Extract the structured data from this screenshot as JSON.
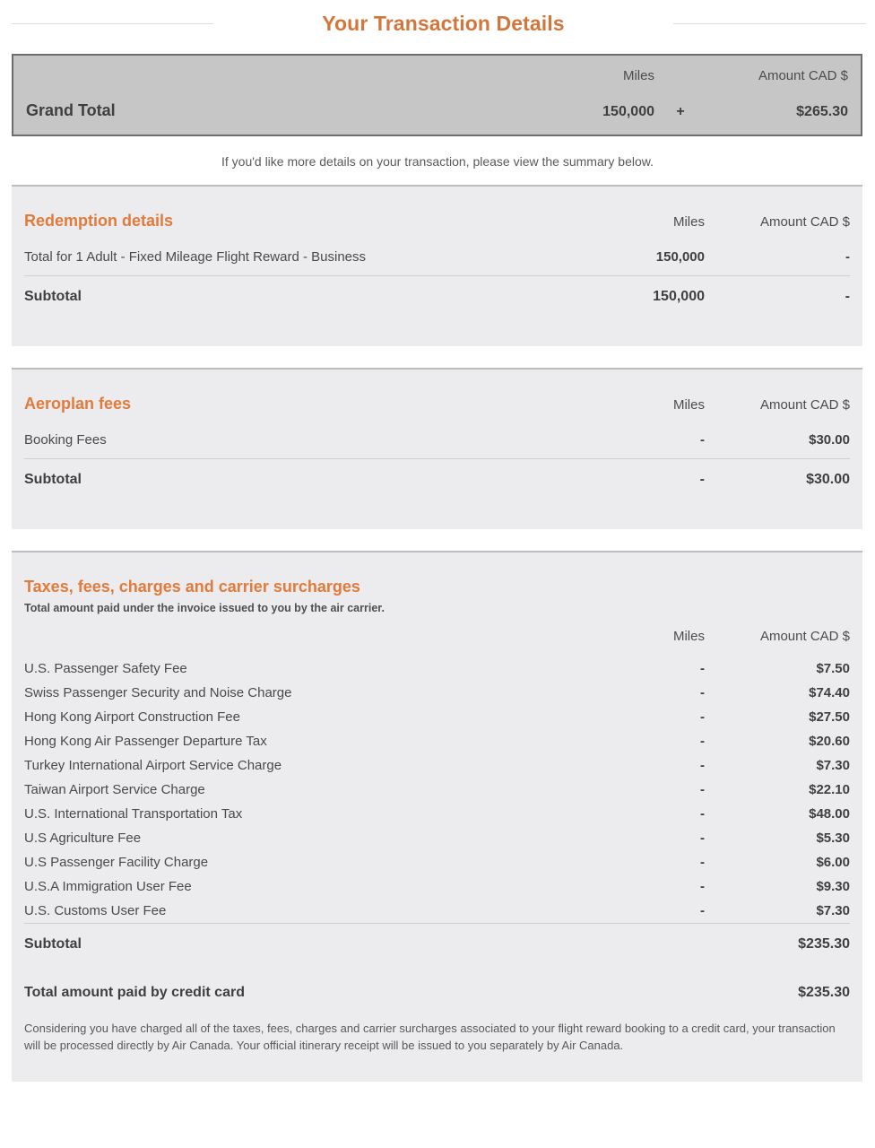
{
  "header": {
    "title": "Your Transaction Details"
  },
  "grand_total": {
    "miles_header": "Miles",
    "amount_header": "Amount CAD $",
    "label": "Grand Total",
    "miles": "150,000",
    "operator": "+",
    "amount": "$265.30"
  },
  "helper_note": "If you'd like more details on your transaction, please view the summary below.",
  "redemption": {
    "title": "Redemption details",
    "miles_header": "Miles",
    "amount_header": "Amount CAD $",
    "rows": [
      {
        "label": "Total for 1 Adult - Fixed Mileage Flight Reward - Business",
        "miles": "150,000",
        "amount": "-"
      }
    ],
    "subtotal": {
      "label": "Subtotal",
      "miles": "150,000",
      "amount": "-"
    }
  },
  "aeroplan_fees": {
    "title": "Aeroplan fees",
    "miles_header": "Miles",
    "amount_header": "Amount CAD $",
    "rows": [
      {
        "label": "Booking Fees",
        "miles": "-",
        "amount": "$30.00"
      }
    ],
    "subtotal": {
      "label": "Subtotal",
      "miles": "-",
      "amount": "$30.00"
    }
  },
  "taxes": {
    "title": "Taxes, fees, charges and carrier surcharges",
    "subnote": "Total amount paid under the invoice issued to you by the air carrier.",
    "miles_header": "Miles",
    "amount_header": "Amount CAD $",
    "rows": [
      {
        "label": "U.S. Passenger Safety Fee",
        "miles": "-",
        "amount": "$7.50"
      },
      {
        "label": "Swiss Passenger Security and Noise Charge",
        "miles": "-",
        "amount": "$74.40"
      },
      {
        "label": "Hong Kong Airport Construction Fee",
        "miles": "-",
        "amount": "$27.50"
      },
      {
        "label": "Hong Kong Air Passenger Departure Tax",
        "miles": "-",
        "amount": "$20.60"
      },
      {
        "label": "Turkey International Airport Service Charge",
        "miles": "-",
        "amount": "$7.30"
      },
      {
        "label": "Taiwan Airport Service Charge",
        "miles": "-",
        "amount": "$22.10"
      },
      {
        "label": "U.S. International Transportation Tax",
        "miles": "-",
        "amount": "$48.00"
      },
      {
        "label": "U.S Agriculture Fee",
        "miles": "-",
        "amount": "$5.30"
      },
      {
        "label": "U.S Passenger Facility Charge",
        "miles": "-",
        "amount": "$6.00"
      },
      {
        "label": "U.S.A Immigration User Fee",
        "miles": "-",
        "amount": "$9.30"
      },
      {
        "label": "U.S. Customs User Fee",
        "miles": "-",
        "amount": "$7.30"
      }
    ],
    "subtotal": {
      "label": "Subtotal",
      "miles": "",
      "amount": "$235.30"
    },
    "total_paid": {
      "label": "Total amount paid by credit card",
      "miles": "",
      "amount": "$235.30"
    },
    "disclaimer": "Considering you have charged all of the taxes, fees, charges and carrier surcharges associated to your flight reward booking to a credit card, your transaction will be processed directly by Air Canada. Your official itinerary receipt will be issued to you separately by Air Canada."
  },
  "colors": {
    "accent_orange": "#e07b3c",
    "title_orange": "#d2763c",
    "panel_bg": "#ecebee",
    "grand_total_bg": "#c6c6c6",
    "grand_total_border": "#6d6d6d",
    "text": "#4a4a4a"
  }
}
